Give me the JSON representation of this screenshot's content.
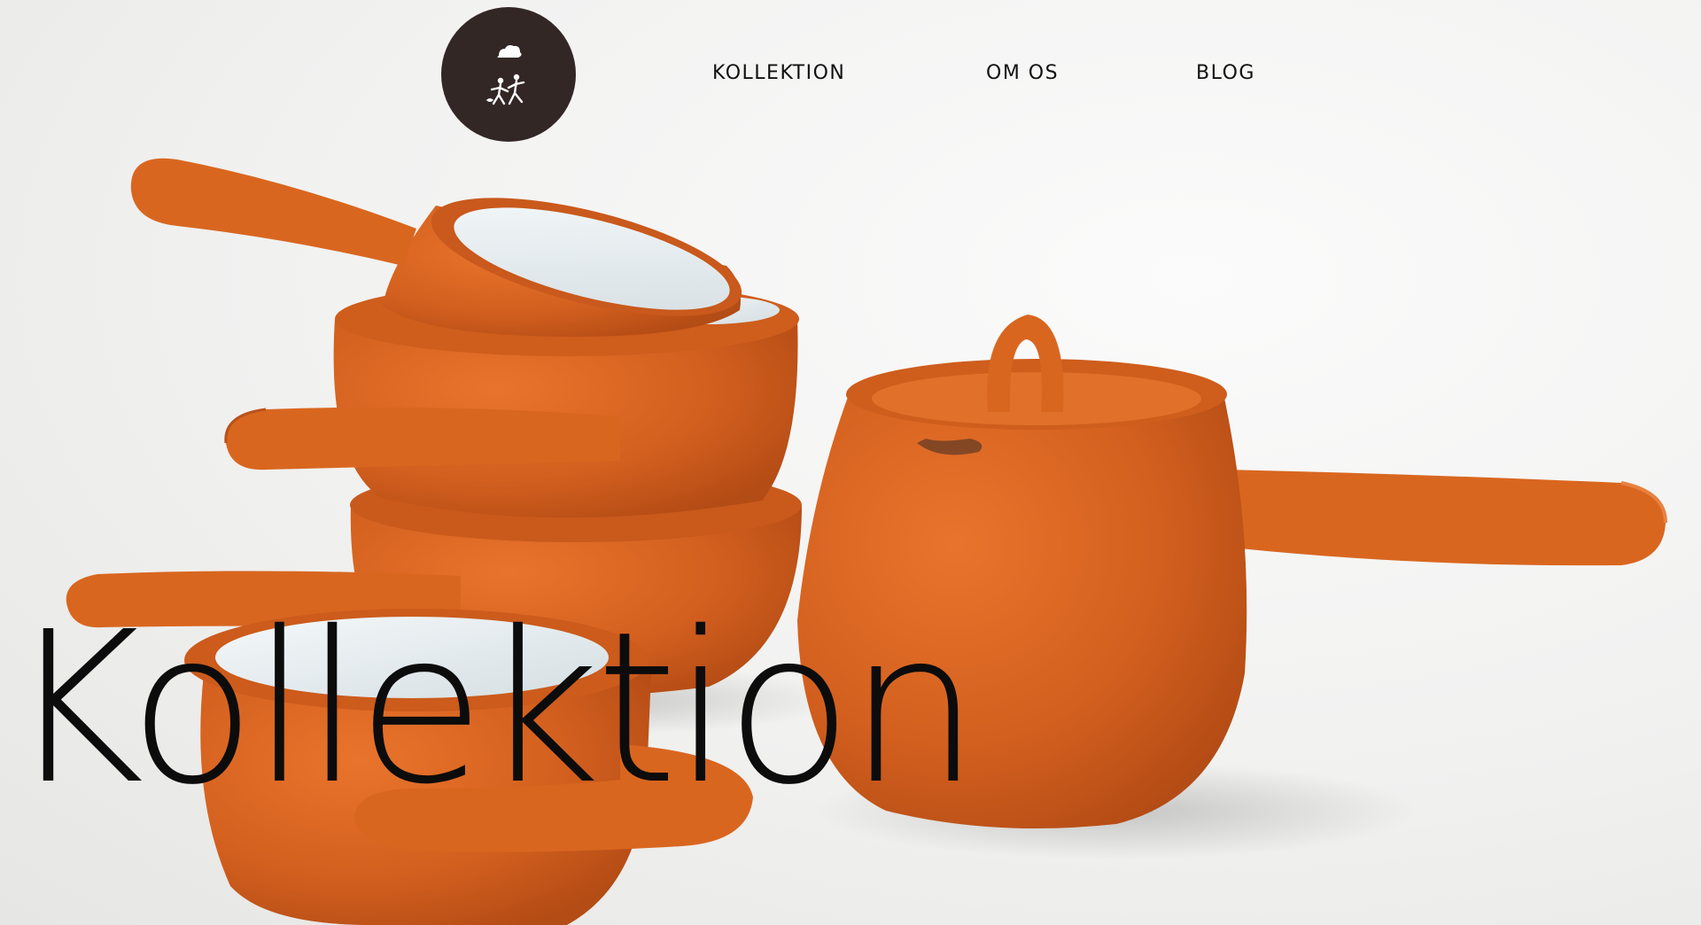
{
  "header": {
    "logo_icon": "running-figures-logo-icon",
    "nav": [
      {
        "label": "KOLLEKTION"
      },
      {
        "label": "OM OS"
      },
      {
        "label": "BLOG"
      }
    ]
  },
  "hero": {
    "title": "Kollektion",
    "image": "terracotta-pots-photo"
  },
  "colors": {
    "terracotta": "#d8611f",
    "logo_background": "#332726",
    "glaze_white": "#e9f0f2",
    "background": "#f2f2f1"
  }
}
